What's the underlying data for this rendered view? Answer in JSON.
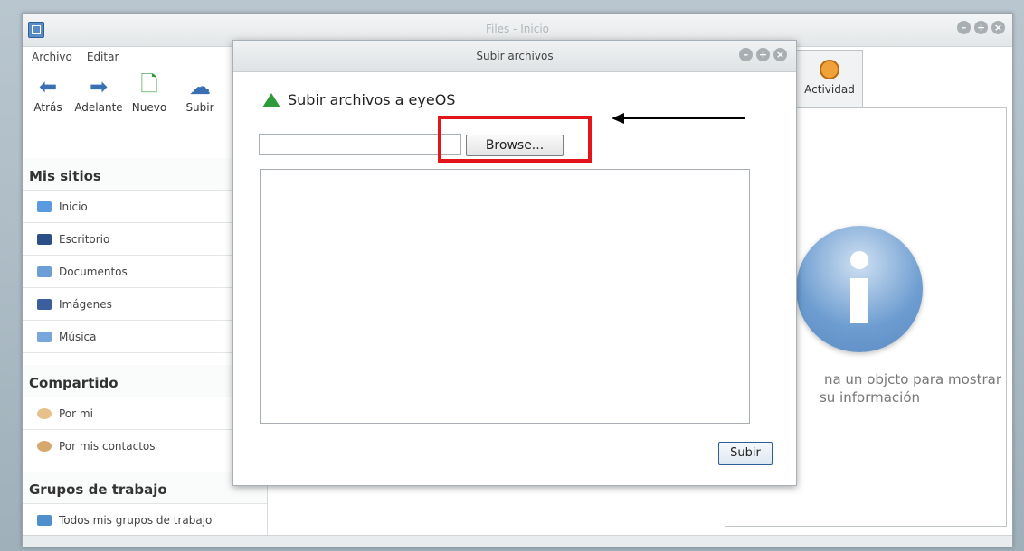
{
  "main_window": {
    "title": "Files - Inicio",
    "menu": [
      "Archivo",
      "Editar"
    ],
    "toolbar": [
      {
        "label": "Atrás",
        "icon": "arrow-left-icon"
      },
      {
        "label": "Adelante",
        "icon": "arrow-right-icon"
      },
      {
        "label": "Nuevo",
        "icon": "new-file-icon"
      },
      {
        "label": "Subir",
        "icon": "upload-icon"
      }
    ],
    "sections": [
      {
        "title": "Mis sitios",
        "items": [
          "Inicio",
          "Escritorio",
          "Documentos",
          "Imágenes",
          "Música"
        ]
      },
      {
        "title": "Compartido",
        "items": [
          "Por mi",
          "Por mis contactos"
        ]
      },
      {
        "title": "Grupos de trabajo",
        "items": [
          "Todos mis grupos de trabajo"
        ]
      }
    ],
    "right_tab": "Actividad",
    "info_text_line1": "na un objcto para mostrar",
    "info_text_line2": "su información"
  },
  "dialog": {
    "title": "Subir archivos",
    "heading": "Subir archivos a eyeOS",
    "file_input_value": "",
    "browse_label": "Browse...",
    "submit_label": "Subir"
  },
  "colors": {
    "highlight": "#e3151b",
    "accent": "#3a6fb4"
  }
}
